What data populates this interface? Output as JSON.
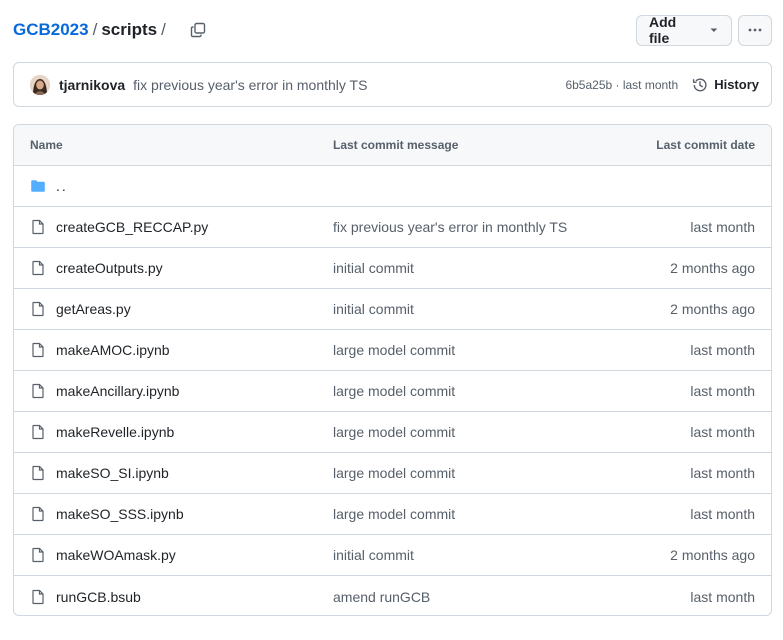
{
  "breadcrumb": {
    "repo": "GCB2023",
    "sep1": "/",
    "dir": "scripts",
    "sep2": "/"
  },
  "toolbar": {
    "add_file_label": "Add file",
    "more_label": "···"
  },
  "latest_commit": {
    "author": "tjarnikova",
    "message": "fix previous year's error in monthly TS",
    "meta": "6b5a25b · last month",
    "history_label": "History"
  },
  "table": {
    "headers": {
      "name": "Name",
      "message": "Last commit message",
      "date": "Last commit date"
    },
    "parent_dir": "..",
    "rows": [
      {
        "name": "createGCB_RECCAP.py",
        "message": "fix previous year's error in monthly TS",
        "date": "last month"
      },
      {
        "name": "createOutputs.py",
        "message": "initial commit",
        "date": "2 months ago"
      },
      {
        "name": "getAreas.py",
        "message": "initial commit",
        "date": "2 months ago"
      },
      {
        "name": "makeAMOC.ipynb",
        "message": "large model commit",
        "date": "last month"
      },
      {
        "name": "makeAncillary.ipynb",
        "message": "large model commit",
        "date": "last month"
      },
      {
        "name": "makeRevelle.ipynb",
        "message": "large model commit",
        "date": "last month"
      },
      {
        "name": "makeSO_SI.ipynb",
        "message": "large model commit",
        "date": "last month"
      },
      {
        "name": "makeSO_SSS.ipynb",
        "message": "large model commit",
        "date": "last month"
      },
      {
        "name": "makeWOAmask.py",
        "message": "initial commit",
        "date": "2 months ago"
      },
      {
        "name": "runGCB.bsub",
        "message": "amend runGCB",
        "date": "last month"
      }
    ]
  },
  "colors": {
    "link": "#0969da",
    "folder": "#54aeff",
    "muted": "#57606a",
    "border": "#d0d7de"
  },
  "icons": {
    "copy": "copy-icon",
    "caret": "triangle-down-icon",
    "history": "history-icon",
    "folder": "folder-icon",
    "file": "file-icon"
  }
}
